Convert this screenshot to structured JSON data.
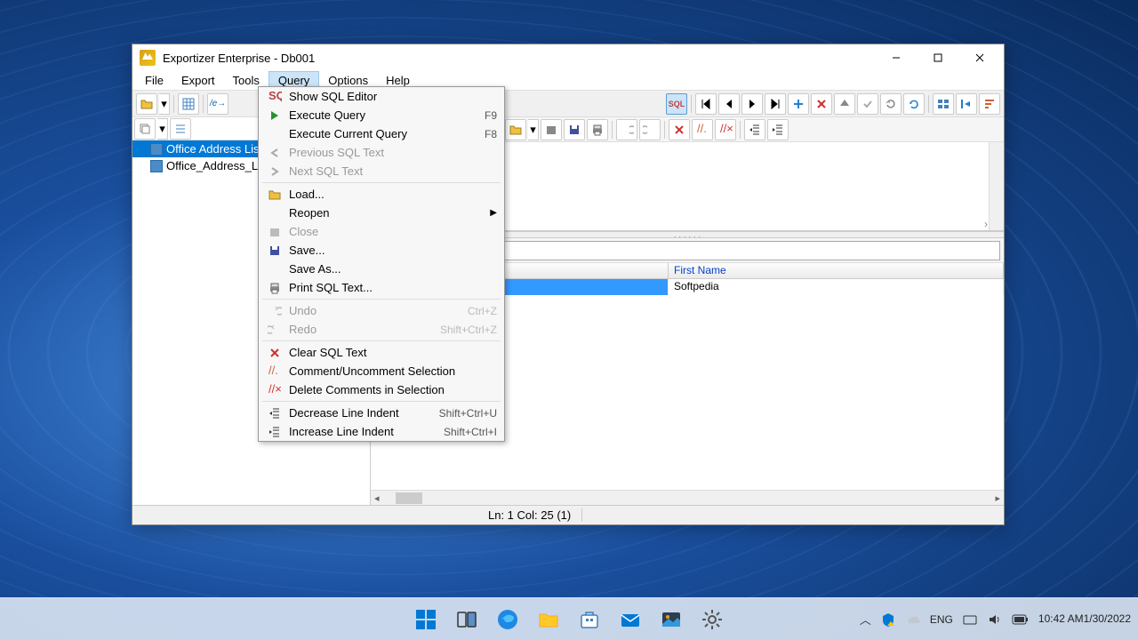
{
  "window": {
    "title": "Exportizer Enterprise - Db001"
  },
  "menubar": {
    "items": [
      "File",
      "Export",
      "Tools",
      "Query",
      "Options",
      "Help"
    ],
    "active_index": 3
  },
  "dropdown": {
    "items": [
      {
        "icon": "sql-icon",
        "label": "Show SQL Editor",
        "shortcut": "",
        "disabled": false
      },
      {
        "icon": "play-icon",
        "label": "Execute Query",
        "shortcut": "F9",
        "disabled": false
      },
      {
        "icon": "",
        "label": "Execute Current Query",
        "shortcut": "F8",
        "disabled": false
      },
      {
        "icon": "arrow-left-icon",
        "label": "Previous SQL Text",
        "shortcut": "",
        "disabled": true
      },
      {
        "icon": "arrow-right-icon",
        "label": "Next SQL Text",
        "shortcut": "",
        "disabled": true
      },
      {
        "sep": true
      },
      {
        "icon": "folder-icon",
        "label": "Load...",
        "shortcut": "",
        "disabled": false
      },
      {
        "icon": "",
        "label": "Reopen",
        "shortcut": "",
        "disabled": false,
        "submenu": true
      },
      {
        "icon": "close-icon",
        "label": "Close",
        "shortcut": "",
        "disabled": true
      },
      {
        "icon": "save-icon",
        "label": "Save...",
        "shortcut": "",
        "disabled": false
      },
      {
        "icon": "",
        "label": "Save As...",
        "shortcut": "",
        "disabled": false
      },
      {
        "icon": "print-icon",
        "label": "Print SQL Text...",
        "shortcut": "",
        "disabled": false
      },
      {
        "sep": true
      },
      {
        "icon": "undo-icon",
        "label": "Undo",
        "shortcut": "Ctrl+Z",
        "disabled": true
      },
      {
        "icon": "redo-icon",
        "label": "Redo",
        "shortcut": "Shift+Ctrl+Z",
        "disabled": true
      },
      {
        "sep": true
      },
      {
        "icon": "clear-icon",
        "label": "Clear SQL Text",
        "shortcut": "",
        "disabled": false
      },
      {
        "icon": "comment-icon",
        "label": "Comment/Uncomment Selection",
        "shortcut": "",
        "disabled": false
      },
      {
        "icon": "delete-comment-icon",
        "label": "Delete Comments in Selection",
        "shortcut": "",
        "disabled": false
      },
      {
        "sep": true
      },
      {
        "icon": "outdent-icon",
        "label": "Decrease Line Indent",
        "shortcut": "Shift+Ctrl+U",
        "disabled": false
      },
      {
        "icon": "indent-icon",
        "label": "Increase Line Indent",
        "shortcut": "Shift+Ctrl+I",
        "disabled": false
      }
    ]
  },
  "tree": {
    "items": [
      {
        "label": "Office Address List",
        "selected": true
      },
      {
        "label": "Office_Address_List",
        "selected": false
      }
    ]
  },
  "grid": {
    "columns": [
      "",
      "First Name"
    ],
    "rows": [
      {
        "col1": "",
        "col2": "Softpedia",
        "selected": true
      }
    ]
  },
  "status": {
    "ln_col": "Ln: 1   Col: 25   (1)"
  },
  "taskbar": {
    "lang": "ENG",
    "time": "10:42 AM",
    "date": "1/30/2022"
  }
}
